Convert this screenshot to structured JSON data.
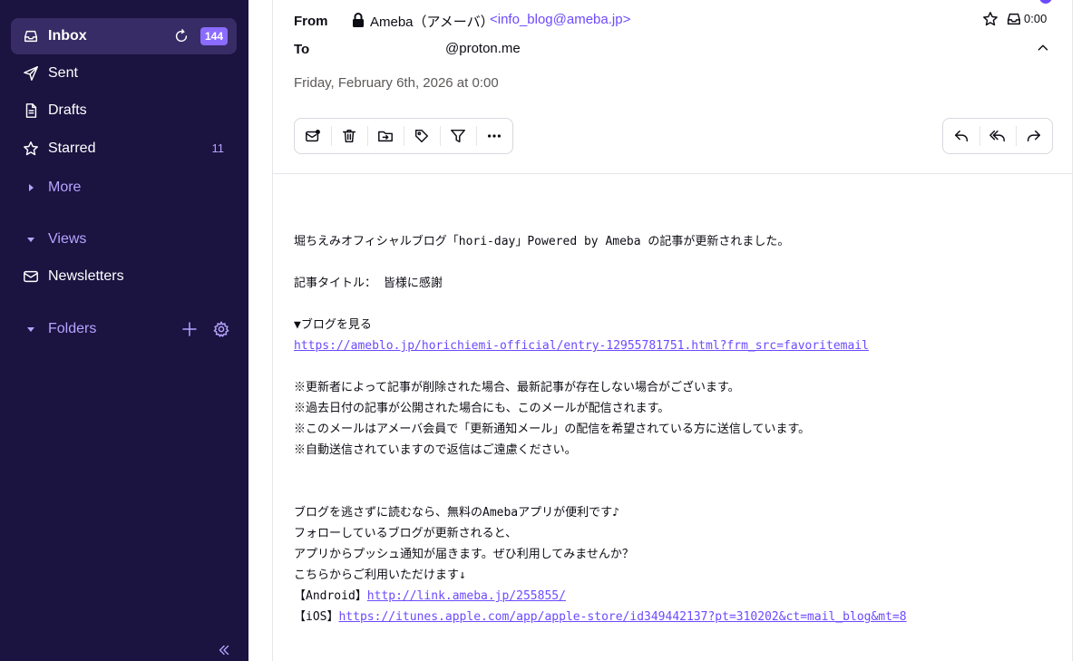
{
  "sidebar": {
    "items": [
      {
        "label": "Inbox",
        "badge": "144"
      },
      {
        "label": "Sent"
      },
      {
        "label": "Drafts"
      },
      {
        "label": "Starred",
        "count": "11"
      },
      {
        "label": "More"
      },
      {
        "label": "Views"
      },
      {
        "label": "Newsletters"
      },
      {
        "label": "Folders"
      }
    ]
  },
  "header": {
    "from_label": "From",
    "from_name": "Ameba（アメーバ）",
    "from_email": "<info_blog@ameba.jp>",
    "to_label": "To",
    "to_value": "@proton.me",
    "date": "Friday, February 6th, 2026 at 0:00",
    "time": "0:00"
  },
  "body": {
    "line1": "堀ちえみオフィシャルブログ「hori-day」Powered by Ameba の記事が更新されました。",
    "line2": "記事タイトル： 皆様に感謝",
    "line3": "▼ブログを見る",
    "link1": "https://ameblo.jp/horichiemi-official/entry-12955781751.html?frm_src=favoritemail",
    "note1": "※更新者によって記事が削除された場合、最新記事が存在しない場合がございます。",
    "note2": "※過去日付の記事が公開された場合にも、このメールが配信されます。",
    "note3": "※このメールはアメーバ会員で「更新通知メール」の配信を希望されている方に送信しています。",
    "note4": "※自動送信されていますので返信はご遠慮ください。",
    "promo1": "ブログを逃さずに読むなら、無料のAmebaアプリが便利です♪",
    "promo2": "フォローしているブログが更新されると、",
    "promo3": "アプリからプッシュ通知が届きます。ぜひ利用してみませんか？",
    "promo4": "こちらからご利用いただけます↓",
    "android_label": "【Android】",
    "android_link": "http://link.ameba.jp/255855/",
    "ios_label": "【iOS】",
    "ios_link": "https://itunes.apple.com/app/apple-store/id349442137?pt=310202&ct=mail_blog&mt=8"
  }
}
